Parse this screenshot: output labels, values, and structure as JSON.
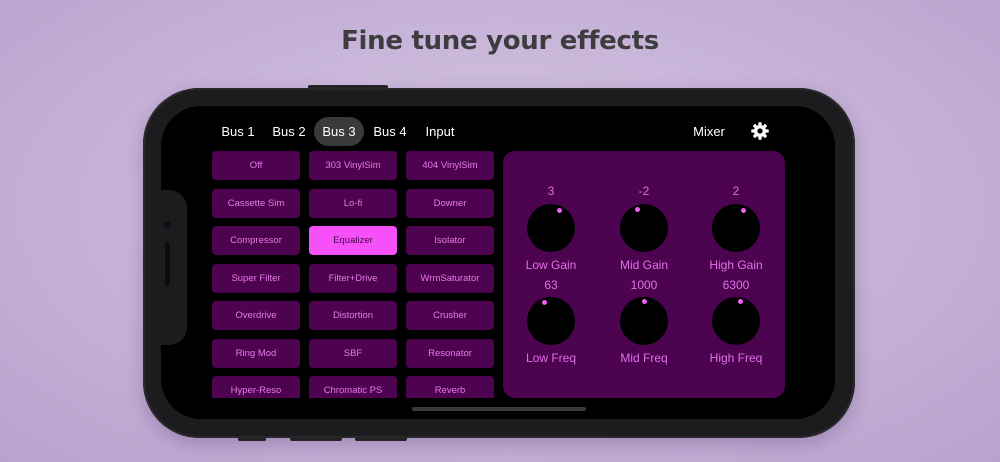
{
  "headline": "Fine tune your effects",
  "tabs": [
    {
      "label": "Bus 1"
    },
    {
      "label": "Bus 2"
    },
    {
      "label": "Bus 3",
      "active": true
    },
    {
      "label": "Bus 4"
    },
    {
      "label": "Input"
    }
  ],
  "mixer_label": "Mixer",
  "effects": {
    "off": "Off",
    "vinyl303": "303 VinylSim",
    "vinyl404": "404 VinylSim",
    "cassette": "Cassette Sim",
    "lofi": "Lo-fi",
    "downer": "Downer",
    "compressor": "Compressor",
    "equalizer": "Equalizer",
    "isolator": "Isolator",
    "superfilter": "Super Filter",
    "filterdrive": "Filter+Drive",
    "wrmsat": "WrmSaturator",
    "overdrive": "Overdrive",
    "distortion": "Distortion",
    "crusher": "Crusher",
    "ringmod": "Ring Mod",
    "sbf": "SBF",
    "resonator": "Resonator",
    "hyperreso": "Hyper-Reso",
    "chromaticps": "Chromatic PS",
    "reverb": "Reverb",
    "selected": "Equalizer"
  },
  "knobs": {
    "low_gain": {
      "value": "3",
      "label": "Low Gain"
    },
    "mid_gain": {
      "value": "-2",
      "label": "Mid Gain"
    },
    "high_gain": {
      "value": "2",
      "label": "High Gain"
    },
    "low_freq": {
      "value": "63",
      "label": "Low Freq"
    },
    "mid_freq": {
      "value": "1000",
      "label": "Mid Freq"
    },
    "high_freq": {
      "value": "6300",
      "label": "High Freq"
    }
  },
  "colors": {
    "accent": "#f651f8",
    "button_bg": "#4e0350",
    "panel_bg": "#4c0350",
    "text_accent": "#e070e6"
  }
}
